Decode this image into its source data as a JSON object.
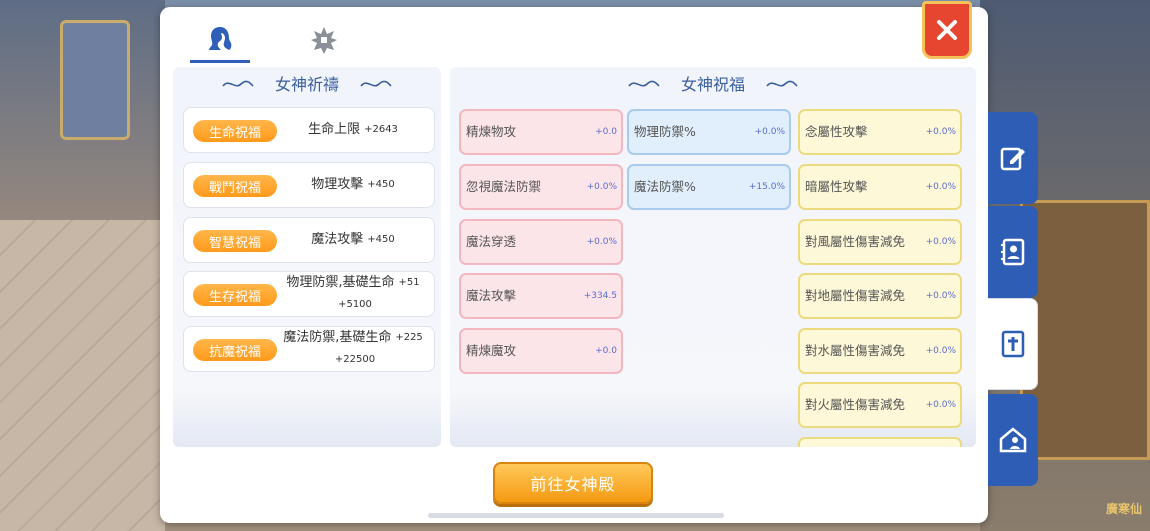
{
  "background": {
    "watermark": "廣寒仙"
  },
  "tabs": [
    {
      "icon": "goddess-icon",
      "active": true
    },
    {
      "icon": "blessing-emblem-icon",
      "active": false
    }
  ],
  "left": {
    "title": "女神祈禱",
    "items": [
      {
        "pill": "生命祝福",
        "text": "生命上限",
        "value": "+2643"
      },
      {
        "pill": "戰鬥祝福",
        "text": "物理攻擊",
        "value": "+450"
      },
      {
        "pill": "智慧祝福",
        "text": "魔法攻擊",
        "value": "+450"
      },
      {
        "pill": "生存祝福",
        "text": "物理防禦,基礎生命",
        "value": "+51",
        "value2": "+5100"
      },
      {
        "pill": "抗魔祝福",
        "text": "魔法防禦,基礎生命",
        "value": "+225",
        "value2": "+22500"
      }
    ]
  },
  "right": {
    "title": "女神祝福",
    "col1": [
      {
        "label": "精煉物攻",
        "value": "+0.0"
      },
      {
        "label": "忽視魔法防禦",
        "value": "+0.0%"
      },
      {
        "label": "魔法穿透",
        "value": "+0.0%"
      },
      {
        "label": "魔法攻擊",
        "value": "+334.5"
      },
      {
        "label": "精煉魔攻",
        "value": "+0.0"
      }
    ],
    "col2": [
      {
        "label": "物理防禦%",
        "value": "+0.0%"
      },
      {
        "label": "魔法防禦%",
        "value": "+15.0%"
      }
    ],
    "col3": [
      {
        "label": "念屬性攻擊",
        "value": "+0.0%"
      },
      {
        "label": "暗屬性攻擊",
        "value": "+0.0%"
      },
      {
        "label": "對風屬性傷害減免",
        "value": "+0.0%"
      },
      {
        "label": "對地屬性傷害減免",
        "value": "+0.0%"
      },
      {
        "label": "對水屬性傷害減免",
        "value": "+0.0%"
      },
      {
        "label": "對火屬性傷害減免",
        "value": "+0.0%"
      }
    ]
  },
  "button": {
    "label": "前往女神殿"
  },
  "side_tabs": [
    {
      "icon": "edit-icon",
      "active": false
    },
    {
      "icon": "contacts-book-icon",
      "active": false
    },
    {
      "icon": "holy-book-icon",
      "active": true
    },
    {
      "icon": "house-person-icon",
      "active": false
    }
  ],
  "colors": {
    "accent": "#2e5db5",
    "orange": "#ff9a1b",
    "close": "#e6452f"
  }
}
